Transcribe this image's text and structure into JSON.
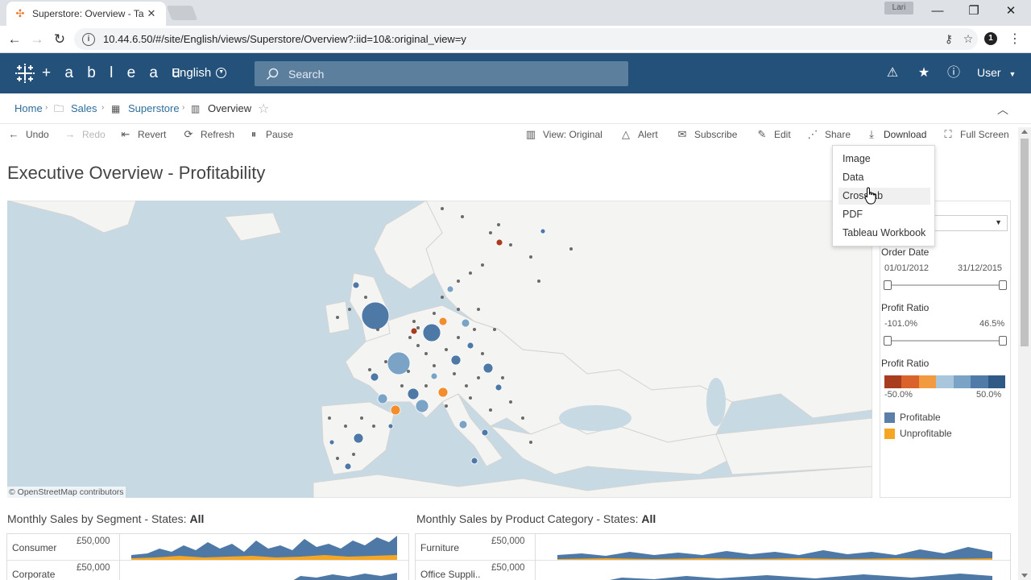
{
  "browser": {
    "tab_title": "Superstore: Overview - Ta",
    "tab_close": "✕",
    "profile_badge": "Lari",
    "url": "10.44.6.50/#/site/English/views/Superstore/Overview?:iid=10&:original_view=y",
    "window_min": "—",
    "window_max": "❐",
    "window_close": "✕"
  },
  "header": {
    "logo_text": "+ a b l e a u",
    "language": "English",
    "search_placeholder": "Search",
    "user_label": "User"
  },
  "breadcrumb": {
    "items": [
      {
        "label": "Home"
      },
      {
        "label": "Sales"
      },
      {
        "label": "Superstore"
      },
      {
        "label": "Overview"
      }
    ]
  },
  "toolbar": {
    "undo": "Undo",
    "redo": "Redo",
    "revert": "Revert",
    "refresh": "Refresh",
    "pause": "Pause",
    "view": "View: Original",
    "alert": "Alert",
    "subscribe": "Subscribe",
    "edit": "Edit",
    "share": "Share",
    "download": "Download",
    "fullscreen": "Full Screen"
  },
  "download_menu": {
    "items": [
      "Image",
      "Data",
      "Crosstab",
      "PDF",
      "Tableau Workbook"
    ],
    "hovered_index": 2
  },
  "dashboard": {
    "title": "Executive Overview - Profitability",
    "map_attribution": "© OpenStreetMap contributors"
  },
  "filters": {
    "order_date": {
      "title": "Order Date",
      "min": "01/01/2012",
      "max": "31/12/2015"
    },
    "profit_ratio_filter": {
      "title": "Profit Ratio",
      "min": "-101.0%",
      "max": "46.5%"
    },
    "profit_ratio_legend": {
      "title": "Profit Ratio",
      "min": "-50.0%",
      "max": "50.0%"
    },
    "legend": [
      {
        "label": "Profitable",
        "color": "#4e79a7"
      },
      {
        "label": "Unprofitable",
        "color": "#f5a623"
      }
    ],
    "ramp_colors": [
      "#a83c1e",
      "#d9632a",
      "#f29a3f",
      "#a9c6dd",
      "#7aa3c6",
      "#507ba8",
      "#2f5a85"
    ]
  },
  "charts": {
    "left": {
      "title_prefix": "Monthly Sales by Segment - States: ",
      "title_value": "All",
      "rows": [
        "Consumer",
        "Corporate"
      ],
      "axis": "£50,000"
    },
    "right": {
      "title_prefix": "Monthly Sales by Product Category - States: ",
      "title_value": "All",
      "rows": [
        "Furniture",
        "Office Suppli.."
      ],
      "axis": "£50,000"
    }
  },
  "colors": {
    "header_bg": "#24517a",
    "link": "#2f6d9a",
    "profit_blue": "#4e79a7",
    "unprofit_orange": "#f28e2b"
  }
}
